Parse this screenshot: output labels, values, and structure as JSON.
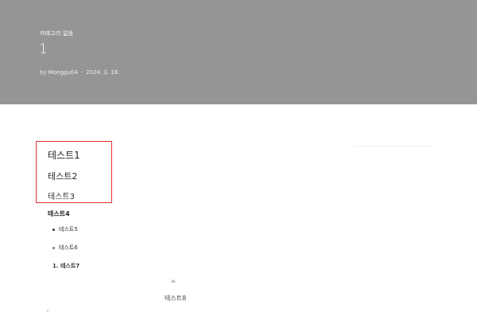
{
  "header": {
    "category": "카테고리 없음",
    "title": "1",
    "author": "by Monggu04",
    "separator": "·",
    "date": "2024. 3. 18."
  },
  "content": {
    "heading1": "테스트1",
    "heading2": "테스트2",
    "heading3": "테스트3",
    "heading4": "테스트4",
    "bullet_item": "테스트5",
    "circle_item": "테스트6",
    "ordered_item": "1. 테스트7",
    "quote_mark": "❝",
    "quote_text": "테스트8"
  },
  "colors": {
    "header_bg": "#959595",
    "highlight_border": "#e53030"
  }
}
